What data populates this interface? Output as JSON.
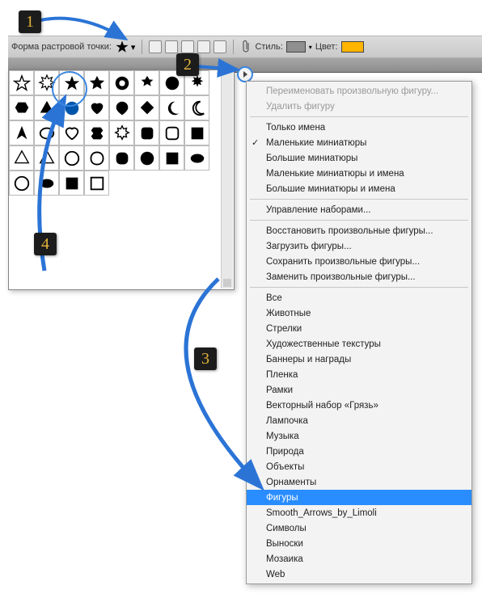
{
  "toolbar": {
    "shape_label": "Форма растровой точки:",
    "style_label": "Стиль:",
    "color_label": "Цвет:",
    "style_swatch": "#8f8f8f",
    "color_swatch": "#ffb400",
    "shape_icon": "star-icon"
  },
  "callouts": {
    "c1": "1",
    "c2": "2",
    "c3": "3",
    "c4": "4"
  },
  "menu": {
    "groups": [
      {
        "items": [
          {
            "label": "Переименовать произвольную фигуру...",
            "disabled": true
          },
          {
            "label": "Удалить фигуру",
            "disabled": true
          }
        ]
      },
      {
        "items": [
          {
            "label": "Только имена"
          },
          {
            "label": "Маленькие миниатюры",
            "checked": true
          },
          {
            "label": "Большие миниатюры"
          },
          {
            "label": "Маленькие миниатюры и имена"
          },
          {
            "label": "Большие миниатюры и имена"
          }
        ]
      },
      {
        "items": [
          {
            "label": "Управление наборами..."
          }
        ]
      },
      {
        "items": [
          {
            "label": "Восстановить произвольные фигуры..."
          },
          {
            "label": "Загрузить фигуры..."
          },
          {
            "label": "Сохранить произвольные фигуры..."
          },
          {
            "label": "Заменить произвольные фигуры..."
          }
        ]
      },
      {
        "items": [
          {
            "label": "Все"
          },
          {
            "label": "Животные"
          },
          {
            "label": "Стрелки"
          },
          {
            "label": "Художественные текстуры"
          },
          {
            "label": "Баннеры и награды"
          },
          {
            "label": "Пленка"
          },
          {
            "label": "Рамки"
          },
          {
            "label": "Векторный набор «Грязь»"
          },
          {
            "label": "Лампочка"
          },
          {
            "label": "Музыка"
          },
          {
            "label": "Природа"
          },
          {
            "label": "Объекты"
          },
          {
            "label": "Орнаменты"
          },
          {
            "label": "Фигуры",
            "highlight": true
          },
          {
            "label": "Smooth_Arrows_by_Limoli"
          },
          {
            "label": "Символы"
          },
          {
            "label": "Выноски"
          },
          {
            "label": "Мозаика"
          },
          {
            "label": "Web"
          }
        ]
      }
    ]
  },
  "shapes_panel": {
    "rows": 5,
    "cols": 8,
    "total": 36
  }
}
